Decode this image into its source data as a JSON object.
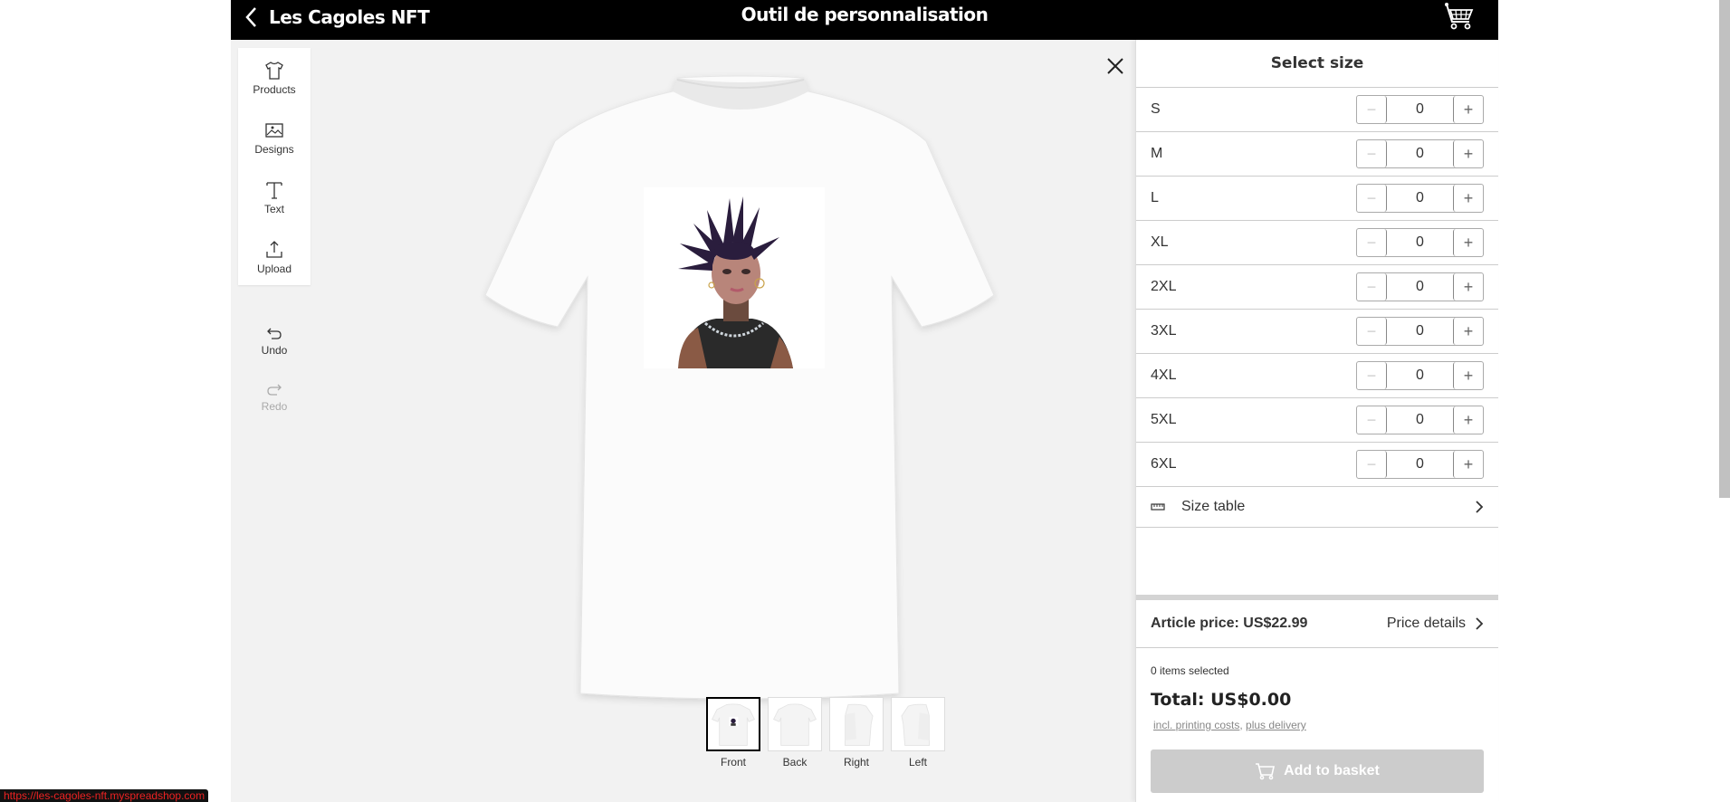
{
  "header": {
    "shop_name": "Les Cagoles NFT",
    "title": "Outil de personnalisation",
    "back_icon": "chevron-left-icon",
    "cart_icon": "shopping-cart-icon"
  },
  "toolbar": {
    "tools": [
      {
        "label": "Products",
        "icon": "tshirt-icon"
      },
      {
        "label": "Designs",
        "icon": "image-icon"
      },
      {
        "label": "Text",
        "icon": "text-icon"
      },
      {
        "label": "Upload",
        "icon": "upload-icon"
      }
    ],
    "undo_label": "Undo",
    "redo_label": "Redo",
    "redo_disabled": true
  },
  "canvas": {
    "close_icon": "close-icon",
    "design_description": "Portrait of a character with spiky purple hair, hoop earrings and a chain necklace",
    "views": [
      {
        "label": "Front",
        "active": true
      },
      {
        "label": "Back",
        "active": false
      },
      {
        "label": "Right",
        "active": false
      },
      {
        "label": "Left",
        "active": false
      }
    ]
  },
  "panel": {
    "title": "Select size",
    "sizes": [
      {
        "label": "S",
        "qty": "0"
      },
      {
        "label": "M",
        "qty": "0"
      },
      {
        "label": "L",
        "qty": "0"
      },
      {
        "label": "XL",
        "qty": "0"
      },
      {
        "label": "2XL",
        "qty": "0"
      },
      {
        "label": "3XL",
        "qty": "0"
      },
      {
        "label": "4XL",
        "qty": "0"
      },
      {
        "label": "5XL",
        "qty": "0"
      },
      {
        "label": "6XL",
        "qty": "0"
      }
    ],
    "minus_symbol": "−",
    "plus_symbol": "+",
    "size_table_label": "Size table",
    "article_price": "Article price: US$22.99",
    "price_details_label": "Price details",
    "items_selected": "0 items selected",
    "total": "Total: US$0.00",
    "incl_printing": "incl. printing costs",
    "separator": ", ",
    "plus_delivery": "plus delivery",
    "add_to_basket": "Add to basket"
  },
  "colors": {
    "header_bg": "#000000",
    "canvas_bg": "#f2f2f2",
    "button_disabled": "#cccccc",
    "status_text": "#ee2222"
  },
  "status_bar": {
    "url": "https://les-cagoles-nft.myspreadshop.com"
  }
}
